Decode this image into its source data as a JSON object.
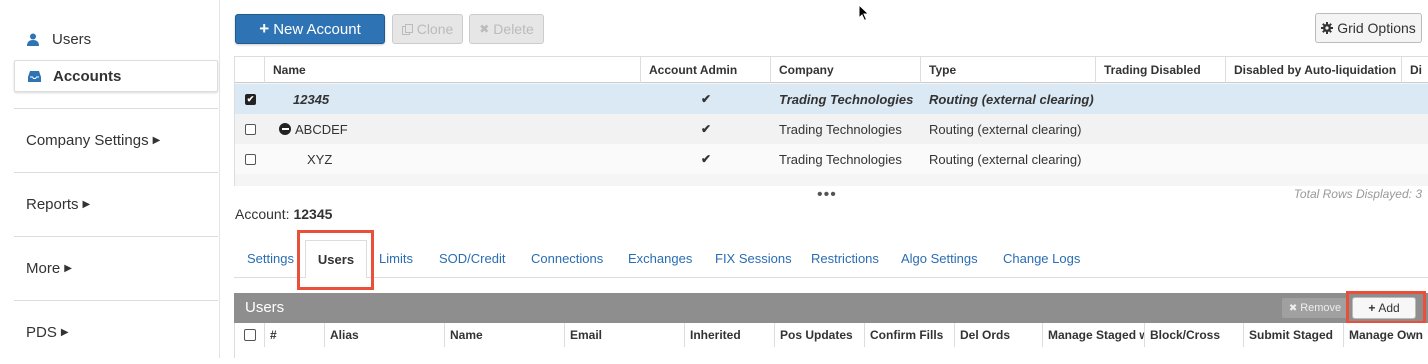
{
  "sidebar": {
    "items": [
      {
        "label": "Users",
        "icon": "user-icon"
      },
      {
        "label": "Accounts",
        "icon": "inbox-icon"
      }
    ],
    "sections": [
      "Company Settings",
      "Reports",
      "More",
      "PDS"
    ]
  },
  "toolbar": {
    "new_account": "New Account",
    "clone": "Clone",
    "delete": "Delete",
    "grid_options": "Grid Options"
  },
  "accounts_grid": {
    "columns": [
      "Name",
      "Account Admin",
      "Company",
      "Type",
      "Trading Disabled",
      "Disabled by Auto-liquidation",
      "Di"
    ],
    "rows": [
      {
        "checked": true,
        "name": "12345",
        "admin": "✔",
        "company": "Trading Technologies",
        "type": "Routing (external clearing)"
      },
      {
        "checked": false,
        "name": "ABCDEF",
        "admin": "✔",
        "company": "Trading Technologies",
        "type": "Routing (external clearing)"
      },
      {
        "checked": false,
        "name": "XYZ",
        "admin": "✔",
        "company": "Trading Technologies",
        "type": "Routing (external clearing)"
      }
    ],
    "ellipsis": "•••",
    "total_rows": "Total Rows Displayed: 3"
  },
  "account": {
    "label": "Account:",
    "value": "12345"
  },
  "tabs": [
    "Settings",
    "Users",
    "Limits",
    "SOD/Credit",
    "Connections",
    "Exchanges",
    "FIX Sessions",
    "Restrictions",
    "Algo Settings",
    "Change Logs"
  ],
  "users_panel": {
    "title": "Users",
    "remove": "Remove",
    "add": "Add",
    "columns": [
      "#",
      "Alias",
      "Name",
      "Email",
      "Inherited",
      "Pos Updates",
      "Confirm Fills",
      "Del Ords",
      "Manage Staged w",
      "Block/Cross",
      "Submit Staged",
      "Manage Own"
    ]
  },
  "colors": {
    "primary": "#2e74b5",
    "highlight": "#e8503a",
    "selected_row": "#dbe9f4",
    "link": "#2a6db2"
  }
}
